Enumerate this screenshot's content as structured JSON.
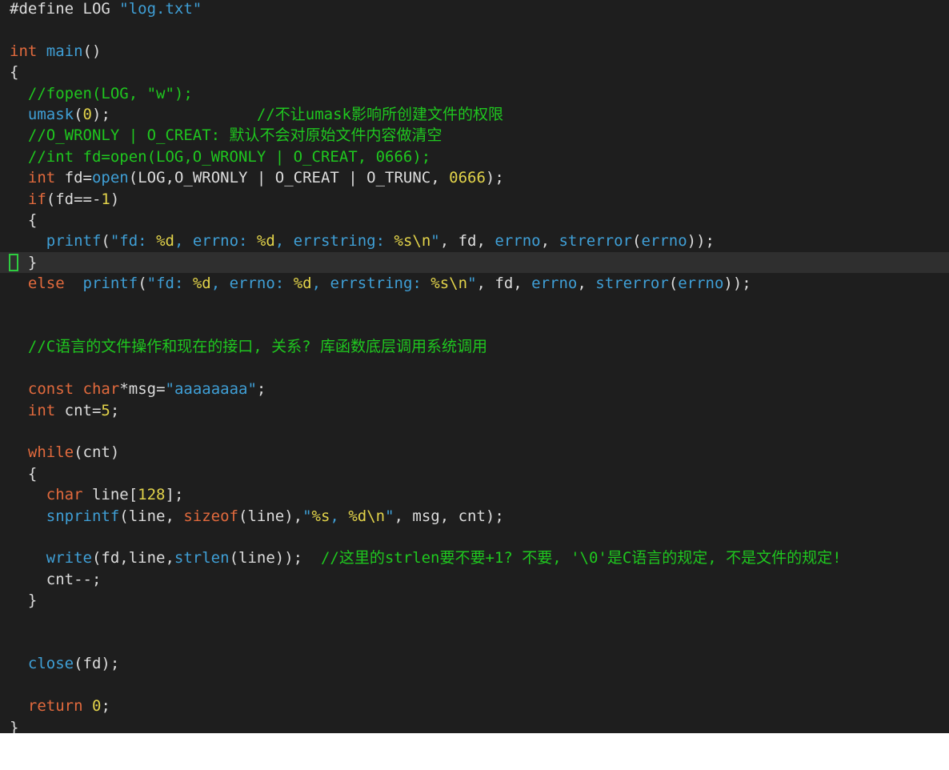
{
  "editor": {
    "cursor_line": 12,
    "colors": {
      "background": "#1e1e1e",
      "current_line": "#2f2f2f",
      "plain": "#dcdcdc",
      "keyword": "#e26a3d",
      "function": "#3f9fd6",
      "string": "#3f9fd6",
      "comment": "#1fc71f",
      "number": "#e2d34a",
      "cursor": "#2ecc40"
    },
    "lines": [
      [
        [
          "plain",
          "#define LOG "
        ],
        [
          "string",
          "\"log.txt\""
        ]
      ],
      [],
      [
        [
          "keyword",
          "int"
        ],
        [
          "plain",
          " "
        ],
        [
          "function",
          "main"
        ],
        [
          "plain",
          "()"
        ]
      ],
      [
        [
          "plain",
          "{"
        ]
      ],
      [
        [
          "plain",
          "  "
        ],
        [
          "comment",
          "//fopen(LOG, \"w\");"
        ]
      ],
      [
        [
          "plain",
          "  "
        ],
        [
          "function",
          "umask"
        ],
        [
          "plain",
          "("
        ],
        [
          "number",
          "0"
        ],
        [
          "plain",
          ");                "
        ],
        [
          "comment",
          "//不让umask影响所创建文件的权限"
        ]
      ],
      [
        [
          "plain",
          "  "
        ],
        [
          "comment",
          "//O_WRONLY | O_CREAT: 默认不会对原始文件内容做清空"
        ]
      ],
      [
        [
          "plain",
          "  "
        ],
        [
          "comment",
          "//int fd=open(LOG,O_WRONLY | O_CREAT, 0666);"
        ]
      ],
      [
        [
          "plain",
          "  "
        ],
        [
          "keyword",
          "int"
        ],
        [
          "plain",
          " fd="
        ],
        [
          "function",
          "open"
        ],
        [
          "plain",
          "(LOG,O_WRONLY | O_CREAT | O_TRUNC, "
        ],
        [
          "number",
          "0666"
        ],
        [
          "plain",
          ");"
        ]
      ],
      [
        [
          "plain",
          "  "
        ],
        [
          "keyword",
          "if"
        ],
        [
          "plain",
          "(fd==-"
        ],
        [
          "number",
          "1"
        ],
        [
          "plain",
          ")"
        ]
      ],
      [
        [
          "plain",
          "  {"
        ]
      ],
      [
        [
          "plain",
          "    "
        ],
        [
          "function",
          "printf"
        ],
        [
          "plain",
          "("
        ],
        [
          "string",
          "\"fd: "
        ],
        [
          "number",
          "%d"
        ],
        [
          "string",
          ", errno: "
        ],
        [
          "number",
          "%d"
        ],
        [
          "string",
          ", errstring: "
        ],
        [
          "number",
          "%s\\n"
        ],
        [
          "string",
          "\""
        ],
        [
          "plain",
          ", fd, "
        ],
        [
          "function",
          "errno"
        ],
        [
          "plain",
          ", "
        ],
        [
          "function",
          "strerror"
        ],
        [
          "plain",
          "("
        ],
        [
          "function",
          "errno"
        ],
        [
          "plain",
          "));"
        ]
      ],
      [
        [
          "plain",
          "  }"
        ]
      ],
      [
        [
          "plain",
          "  "
        ],
        [
          "keyword",
          "else"
        ],
        [
          "plain",
          "  "
        ],
        [
          "function",
          "printf"
        ],
        [
          "plain",
          "("
        ],
        [
          "string",
          "\"fd: "
        ],
        [
          "number",
          "%d"
        ],
        [
          "string",
          ", errno: "
        ],
        [
          "number",
          "%d"
        ],
        [
          "string",
          ", errstring: "
        ],
        [
          "number",
          "%s\\n"
        ],
        [
          "string",
          "\""
        ],
        [
          "plain",
          ", fd, "
        ],
        [
          "function",
          "errno"
        ],
        [
          "plain",
          ", "
        ],
        [
          "function",
          "strerror"
        ],
        [
          "plain",
          "("
        ],
        [
          "function",
          "errno"
        ],
        [
          "plain",
          "));"
        ]
      ],
      [],
      [],
      [
        [
          "plain",
          "  "
        ],
        [
          "comment",
          "//C语言的文件操作和现在的接口, 关系? 库函数底层调用系统调用"
        ]
      ],
      [],
      [
        [
          "plain",
          "  "
        ],
        [
          "keyword",
          "const"
        ],
        [
          "plain",
          " "
        ],
        [
          "keyword",
          "char"
        ],
        [
          "plain",
          "*msg="
        ],
        [
          "string",
          "\"aaaaaaaa\""
        ],
        [
          "plain",
          ";"
        ]
      ],
      [
        [
          "plain",
          "  "
        ],
        [
          "keyword",
          "int"
        ],
        [
          "plain",
          " cnt="
        ],
        [
          "number",
          "5"
        ],
        [
          "plain",
          ";"
        ]
      ],
      [],
      [
        [
          "plain",
          "  "
        ],
        [
          "keyword",
          "while"
        ],
        [
          "plain",
          "(cnt)"
        ]
      ],
      [
        [
          "plain",
          "  {"
        ]
      ],
      [
        [
          "plain",
          "    "
        ],
        [
          "keyword",
          "char"
        ],
        [
          "plain",
          " line["
        ],
        [
          "number",
          "128"
        ],
        [
          "plain",
          "];"
        ]
      ],
      [
        [
          "plain",
          "    "
        ],
        [
          "function",
          "snprintf"
        ],
        [
          "plain",
          "(line, "
        ],
        [
          "keyword",
          "sizeof"
        ],
        [
          "plain",
          "(line),"
        ],
        [
          "string",
          "\""
        ],
        [
          "number",
          "%s"
        ],
        [
          "string",
          ", "
        ],
        [
          "number",
          "%d\\n"
        ],
        [
          "string",
          "\""
        ],
        [
          "plain",
          ", msg, cnt);"
        ]
      ],
      [],
      [
        [
          "plain",
          "    "
        ],
        [
          "function",
          "write"
        ],
        [
          "plain",
          "(fd,line,"
        ],
        [
          "function",
          "strlen"
        ],
        [
          "plain",
          "(line));  "
        ],
        [
          "comment",
          "//这里的strlen要不要+1? 不要, '\\0'是C语言的规定, 不是文件的规定!"
        ]
      ],
      [
        [
          "plain",
          "    cnt--;"
        ]
      ],
      [
        [
          "plain",
          "  }"
        ]
      ],
      [],
      [],
      [
        [
          "plain",
          "  "
        ],
        [
          "function",
          "close"
        ],
        [
          "plain",
          "(fd);"
        ]
      ],
      [],
      [
        [
          "plain",
          "  "
        ],
        [
          "keyword",
          "return"
        ],
        [
          "plain",
          " "
        ],
        [
          "number",
          "0"
        ],
        [
          "plain",
          ";"
        ]
      ],
      [
        [
          "plain",
          "}"
        ]
      ]
    ]
  }
}
